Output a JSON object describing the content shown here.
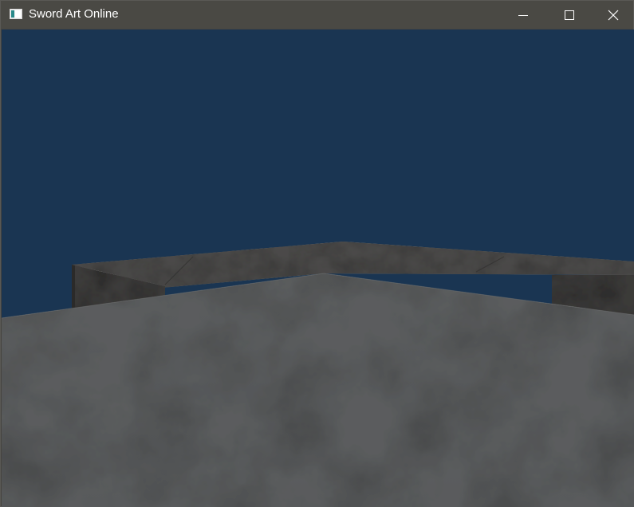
{
  "window": {
    "title": "Sword Art Online",
    "icon": "application-window-icon",
    "controls": {
      "minimize": "minimize-icon",
      "maximize": "maximize-icon",
      "close": "close-icon"
    }
  },
  "scene": {
    "sky_color": "#1a3552",
    "wall_top_color": "#4b4a49",
    "wall_face_color": "#3d3c3b",
    "floor_color": "#5b5d5e"
  }
}
